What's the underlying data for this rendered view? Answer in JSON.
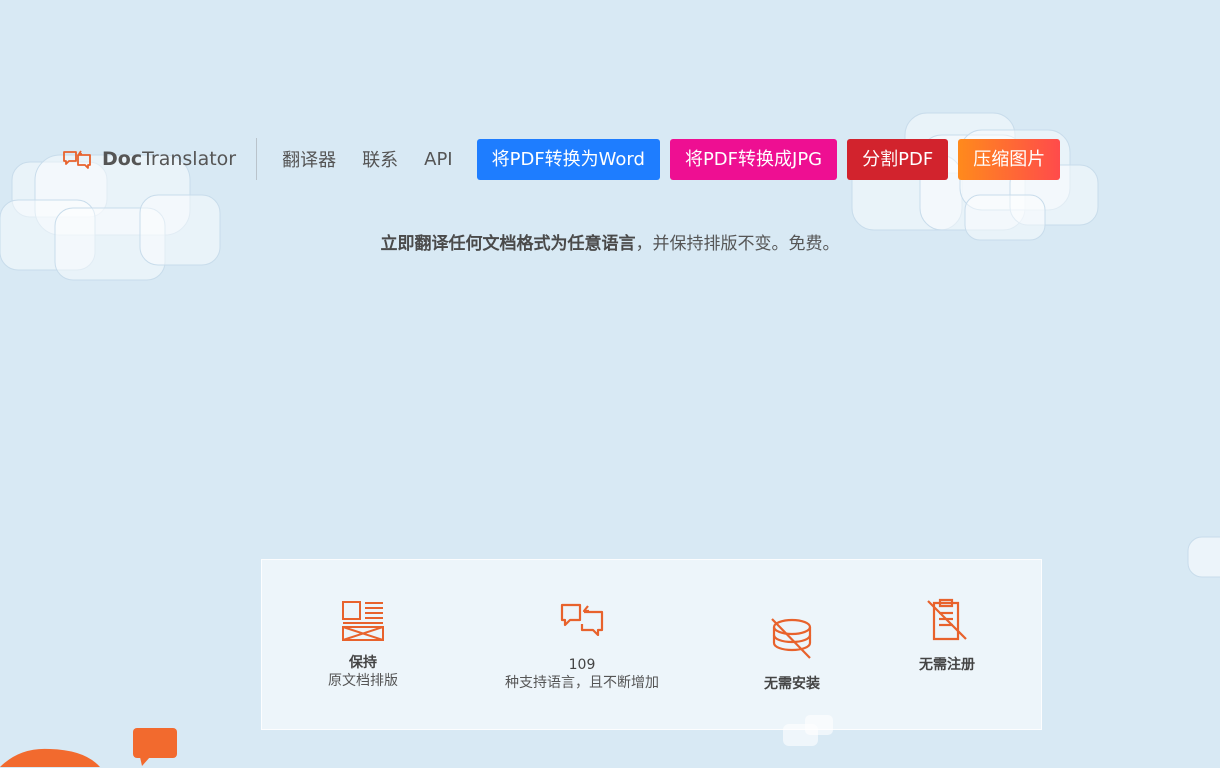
{
  "header": {
    "logo_bold": "Doc",
    "logo_rest": "Translator",
    "nav": [
      "翻译器",
      "联系",
      "API"
    ],
    "buttons": [
      "将PDF转换为Word",
      "将PDF转换成JPG",
      "分割PDF",
      "压缩图片"
    ]
  },
  "tagline": {
    "bold": "立即翻译任何文档格式为任意语言",
    "rest": "，并保持排版不变。免费。"
  },
  "features": {
    "layout": {
      "title": "保持",
      "subtitle": "原文档排版",
      "icon": "document-layout-icon"
    },
    "languages": {
      "number": "109",
      "subtitle": "种支持语言，且不断增加",
      "icon": "translate-bubbles-icon"
    },
    "install": {
      "title": "无需安装",
      "icon": "no-install-coins-icon"
    },
    "register": {
      "title": "无需注册",
      "icon": "no-registration-icon"
    }
  },
  "colors": {
    "accent": "#e8622c",
    "blue": "#1e7dff",
    "pink": "#ee0f92",
    "red": "#d2232d",
    "orange": "#ff8a1c"
  }
}
